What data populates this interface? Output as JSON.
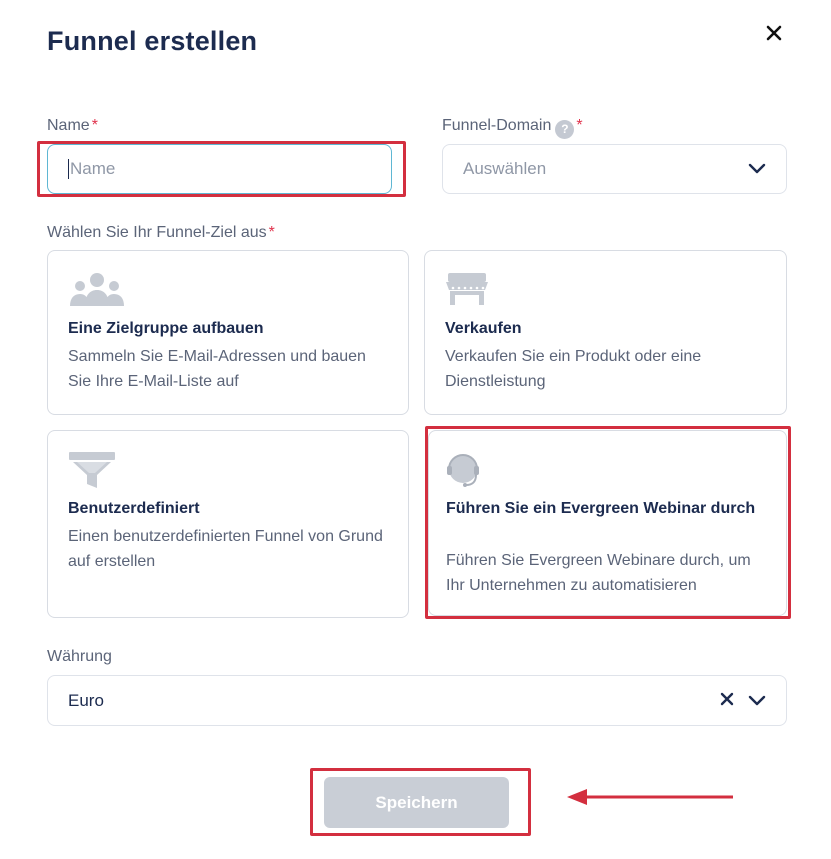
{
  "dialog": {
    "title": "Funnel erstellen"
  },
  "name_field": {
    "label": "Name",
    "required_mark": "*",
    "placeholder": "Name",
    "value": ""
  },
  "domain_field": {
    "label": "Funnel-Domain",
    "help_icon": "question-circle-icon",
    "help_glyph": "?",
    "required_mark": "*",
    "selected": "Auswählen"
  },
  "goal": {
    "label": "Wählen Sie Ihr Funnel-Ziel aus",
    "required_mark": "*",
    "options": [
      {
        "icon": "audience-group-icon",
        "title": "Eine Zielgruppe aufbauen",
        "description": "Sammeln Sie E-Mail-Adressen und bauen Sie Ihre E-Mail-Liste auf"
      },
      {
        "icon": "storefront-icon",
        "title": "Verkaufen",
        "description": "Verkaufen Sie ein Produkt oder eine Dienstleistung"
      },
      {
        "icon": "funnel-icon",
        "title": "Benutzerdefiniert",
        "description": "Einen benutzerdefinierten Funnel von Grund auf erstellen"
      },
      {
        "icon": "headset-icon",
        "title": "Führen Sie ein Evergreen Webinar durch",
        "description": "Führen Sie Evergreen Webinare durch, um Ihr Unternehmen zu automatisieren"
      }
    ]
  },
  "currency": {
    "label": "Währung",
    "selected": "Euro"
  },
  "save_button": {
    "label": "Speichern"
  },
  "colors": {
    "title": "#1c2b4f",
    "required": "#e0314b",
    "focus_border": "#5fb7d3",
    "highlight": "#d32f3f",
    "button_disabled": "#c9ced6",
    "icon_gray": "#c6cbd3"
  }
}
